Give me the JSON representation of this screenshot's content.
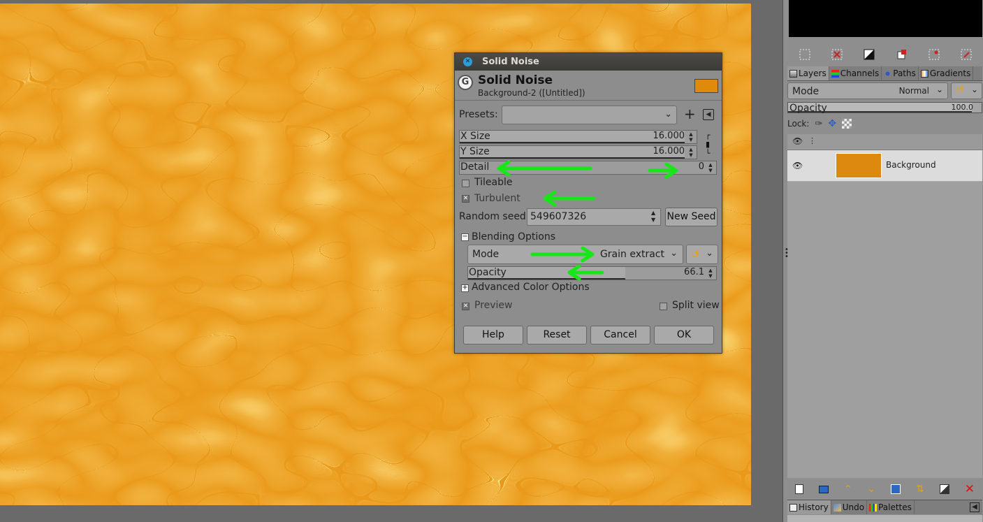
{
  "dialog": {
    "window_title": "Solid Noise",
    "header_title": "Solid Noise",
    "header_subtitle": "Background-2 ([Untitled])",
    "swatch_color": "#e08a0a",
    "presets_label": "Presets:",
    "presets_value": "",
    "x_size": {
      "label": "X Size",
      "value": "16.000"
    },
    "y_size": {
      "label": "Y Size",
      "value": "16.000"
    },
    "detail": {
      "label": "Detail",
      "value": "0"
    },
    "tileable": {
      "label": "Tileable",
      "checked": false
    },
    "turbulent": {
      "label": "Turbulent",
      "checked": true
    },
    "random_seed": {
      "label": "Random seed",
      "value": "549607326"
    },
    "new_seed_label": "New Seed",
    "blending": {
      "label": "Blending Options",
      "mode_label": "Mode",
      "mode_value": "Grain extract",
      "opacity_label": "Opacity",
      "opacity_value": "66.1",
      "opacity_fraction": 0.661
    },
    "advanced_label": "Advanced Color Options",
    "preview": {
      "label": "Preview",
      "checked": true
    },
    "split_view": {
      "label": "Split view",
      "checked": false
    },
    "buttons": {
      "help": "Help",
      "reset": "Reset",
      "cancel": "Cancel",
      "ok": "OK"
    }
  },
  "layers_panel": {
    "tabs": [
      "Layers",
      "Channels",
      "Paths",
      "Gradients"
    ],
    "mode_label": "Mode",
    "mode_value": "Normal",
    "opacity_label": "Opacity",
    "opacity_value": "100.0",
    "lock_label": "Lock:",
    "layer_name": "Background",
    "layer_color": "#dd8910"
  },
  "bottom_tabs": [
    "History",
    "Undo",
    "Palettes"
  ],
  "annotation_color": "#19e619"
}
